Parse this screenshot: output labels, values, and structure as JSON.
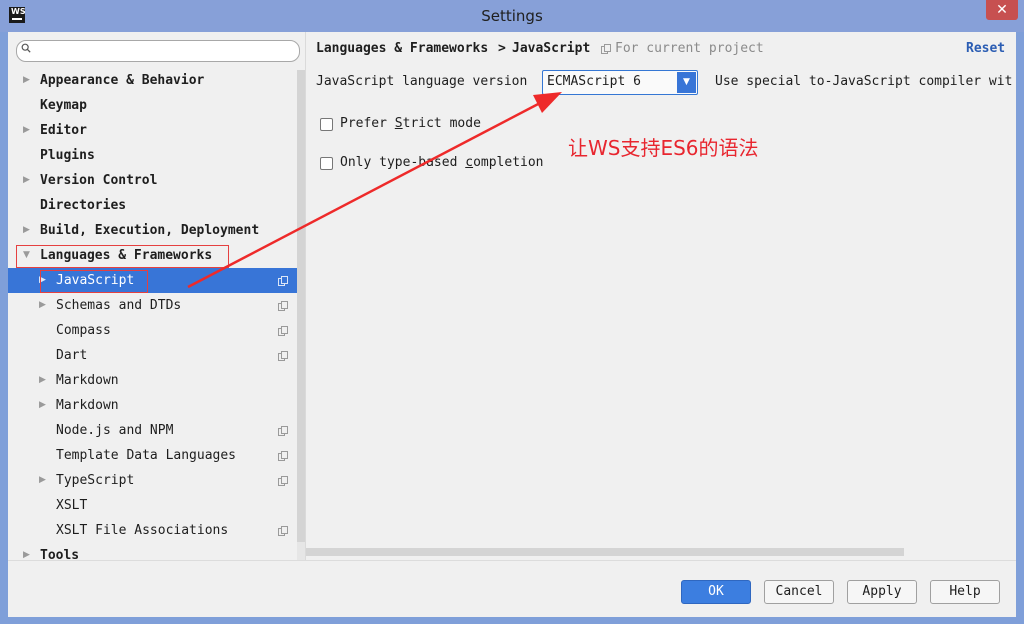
{
  "window": {
    "title": "Settings",
    "app_icon_text": "WS",
    "close_symbol": "✕"
  },
  "search": {
    "value": "",
    "placeholder": ""
  },
  "tree": [
    {
      "label": "Appearance & Behavior",
      "expandable": true,
      "bold": true,
      "indent": 0,
      "shared": false
    },
    {
      "label": "Keymap",
      "expandable": false,
      "bold": true,
      "indent": 0,
      "shared": false
    },
    {
      "label": "Editor",
      "expandable": true,
      "bold": true,
      "indent": 0,
      "shared": false
    },
    {
      "label": "Plugins",
      "expandable": false,
      "bold": true,
      "indent": 0,
      "shared": false
    },
    {
      "label": "Version Control",
      "expandable": true,
      "bold": true,
      "indent": 0,
      "shared": false
    },
    {
      "label": "Directories",
      "expandable": false,
      "bold": true,
      "indent": 0,
      "shared": false
    },
    {
      "label": "Build, Execution, Deployment",
      "expandable": true,
      "bold": true,
      "indent": 0,
      "shared": false
    },
    {
      "label": "Languages & Frameworks",
      "expandable": true,
      "expanded": true,
      "bold": true,
      "indent": 0,
      "shared": false
    },
    {
      "label": "JavaScript",
      "expandable": true,
      "bold": false,
      "indent": 1,
      "shared": true,
      "selected": true
    },
    {
      "label": "Schemas and DTDs",
      "expandable": true,
      "bold": false,
      "indent": 1,
      "shared": true
    },
    {
      "label": "Compass",
      "expandable": false,
      "bold": false,
      "indent": 1,
      "shared": true
    },
    {
      "label": "Dart",
      "expandable": false,
      "bold": false,
      "indent": 1,
      "shared": true
    },
    {
      "label": "Markdown",
      "expandable": true,
      "bold": false,
      "indent": 1,
      "shared": false
    },
    {
      "label": "Markdown",
      "expandable": true,
      "bold": false,
      "indent": 1,
      "shared": false
    },
    {
      "label": "Node.js and NPM",
      "expandable": false,
      "bold": false,
      "indent": 1,
      "shared": true
    },
    {
      "label": "Template Data Languages",
      "expandable": false,
      "bold": false,
      "indent": 1,
      "shared": true
    },
    {
      "label": "TypeScript",
      "expandable": true,
      "bold": false,
      "indent": 1,
      "shared": true
    },
    {
      "label": "XSLT",
      "expandable": false,
      "bold": false,
      "indent": 1,
      "shared": false
    },
    {
      "label": "XSLT File Associations",
      "expandable": false,
      "bold": false,
      "indent": 1,
      "shared": true
    },
    {
      "label": "Tools",
      "expandable": true,
      "bold": true,
      "indent": 0,
      "shared": false
    }
  ],
  "breadcrumb": {
    "parent": "Languages & Frameworks",
    "separator": ">",
    "current": "JavaScript",
    "scope": "For current project"
  },
  "reset_label": "Reset",
  "language_version": {
    "label": "JavaScript language version",
    "selected": "ECMAScript 6",
    "compiler_text": "Use special to-JavaScript compiler wit"
  },
  "options": {
    "strict": {
      "pre": "Prefer ",
      "u": "S",
      "post": "trict mode",
      "checked": false
    },
    "type_based": {
      "pre": "Only type-based ",
      "u": "c",
      "post": "ompletion",
      "checked": false
    }
  },
  "annotation": "让WS支持ES6的语法",
  "buttons": {
    "ok": "OK",
    "cancel": "Cancel",
    "apply": "Apply",
    "help": "Help"
  },
  "colors": {
    "selection": "#3875d7",
    "annotation_red": "#e8262f",
    "link": "#2b5db3"
  },
  "icons": {
    "expand_arrow": "▶",
    "expanded_arrow": "▼",
    "dropdown": "▼"
  }
}
